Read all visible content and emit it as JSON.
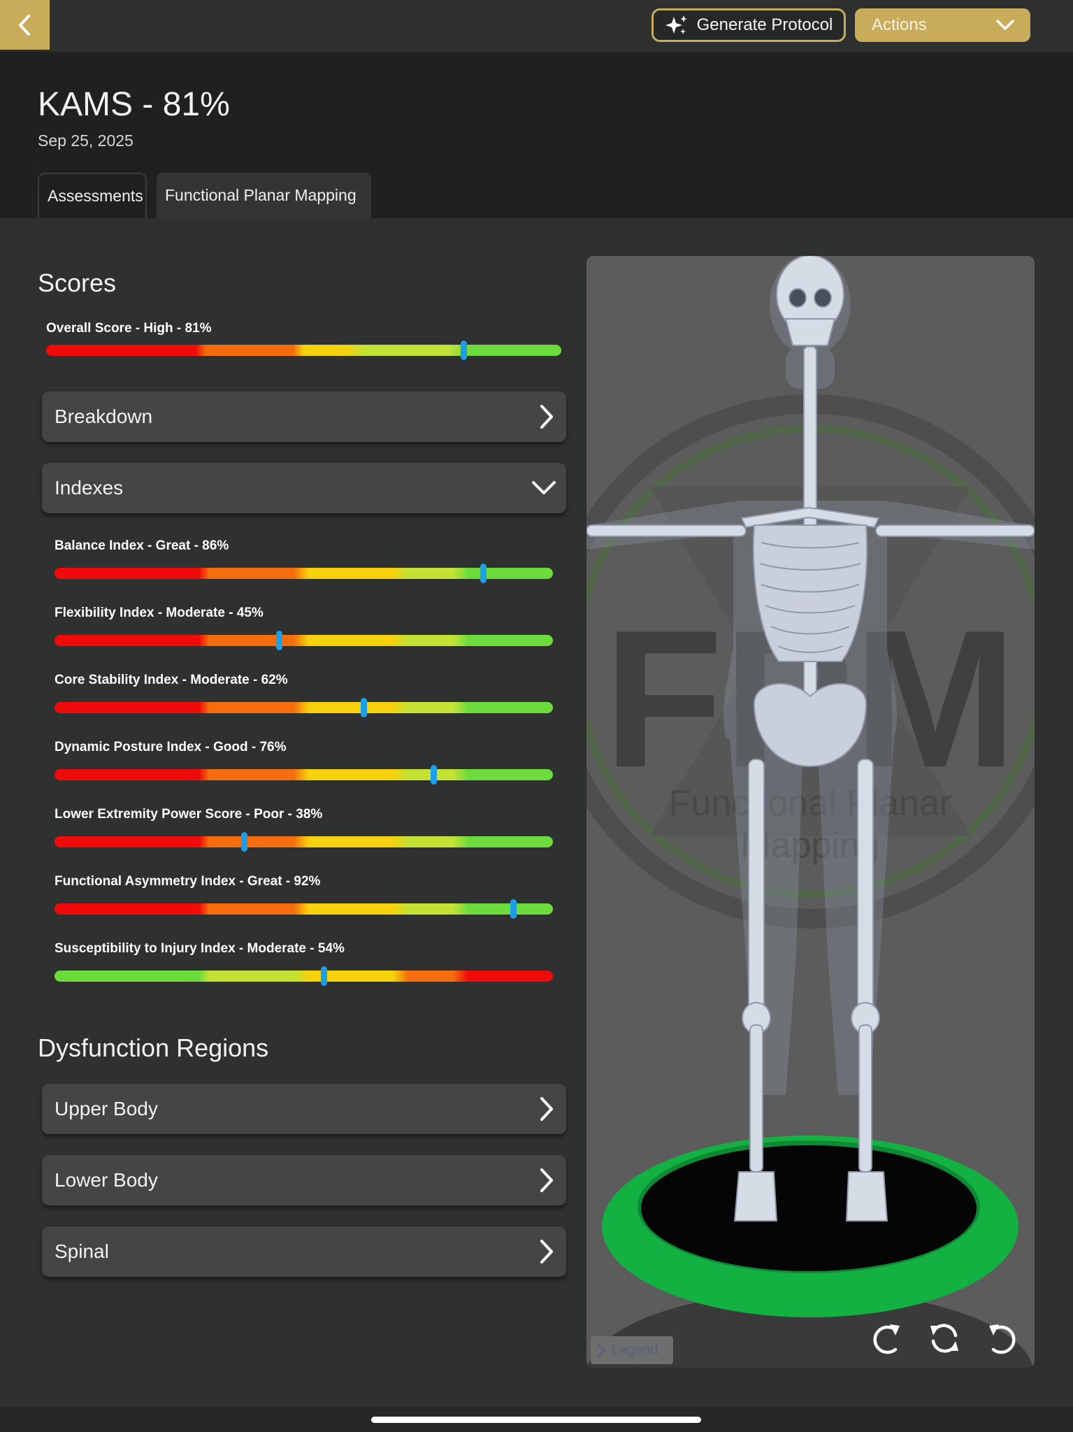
{
  "topbar": {
    "back_icon": "chevron-left-icon",
    "generate_label": "Generate Protocol",
    "generate_icon": "sparkle-icon",
    "actions_label": "Actions",
    "actions_icon": "chevron-down-icon"
  },
  "header": {
    "title": "KAMS - 81%",
    "date": "Sep 25, 2025",
    "tabs": [
      {
        "label": "Assessments",
        "active": false
      },
      {
        "label": "Functional Planar Mapping",
        "active": true
      }
    ]
  },
  "scores": {
    "title": "Scores",
    "overall": {
      "label": "Overall Score - High - 81%",
      "value": 81
    }
  },
  "sections": {
    "breakdown": "Breakdown",
    "indexes": "Indexes"
  },
  "indexes": [
    {
      "label": "Balance Index - Great - 86%",
      "value": 86,
      "scale": "normal"
    },
    {
      "label": "Flexibility Index - Moderate - 45%",
      "value": 45,
      "scale": "normal"
    },
    {
      "label": "Core Stability Index - Moderate - 62%",
      "value": 62,
      "scale": "normal"
    },
    {
      "label": "Dynamic Posture Index - Good - 76%",
      "value": 76,
      "scale": "normal"
    },
    {
      "label": "Lower Extremity Power Score - Poor - 38%",
      "value": 38,
      "scale": "normal"
    },
    {
      "label": "Functional Asymmetry Index - Great - 92%",
      "value": 92,
      "scale": "normal"
    },
    {
      "label": "Susceptibility to Injury Index - Moderate - 54%",
      "value": 54,
      "scale": "reverse"
    }
  ],
  "dysfunction": {
    "title": "Dysfunction Regions",
    "regions": [
      "Upper Body",
      "Lower Body",
      "Spinal"
    ]
  },
  "viewer": {
    "watermark_big": "FPM",
    "watermark_line1": "Functional Planar",
    "watermark_line2": "Mapping",
    "legend_label": "Legend",
    "controls": [
      "rotate-right-icon",
      "reset-rotation-icon",
      "rotate-left-icon"
    ]
  },
  "colors": {
    "accent": "#c9ac5a",
    "marker": "#1d9ee8",
    "red": "#f10a0a",
    "orange": "#f56d0c",
    "yellow": "#f5d20c",
    "lime": "#c2e234",
    "green": "#6cdc3d",
    "platform": "#12b142"
  }
}
